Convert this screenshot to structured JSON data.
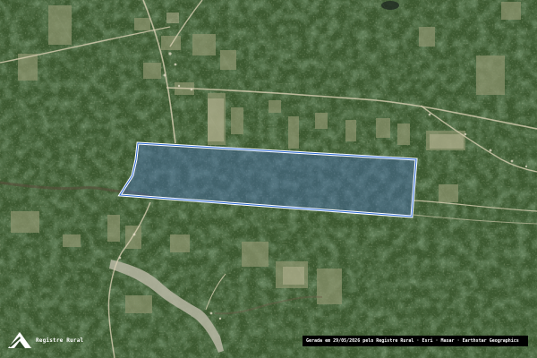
{
  "branding": {
    "name": "Registre Rural",
    "logo_icon": "registre-rural-logo-icon"
  },
  "attribution": {
    "text": "Gerada em 29/05/2026 pelo Registre Rural · Esri · Maxar · Earthstar Geographics"
  },
  "map": {
    "basemap": "satellite imagery",
    "property_polygon": {
      "fill_color": "#4a6fb5",
      "stroke_color": "#ffffff",
      "inner_stroke_color": "#2e6bd6"
    }
  }
}
